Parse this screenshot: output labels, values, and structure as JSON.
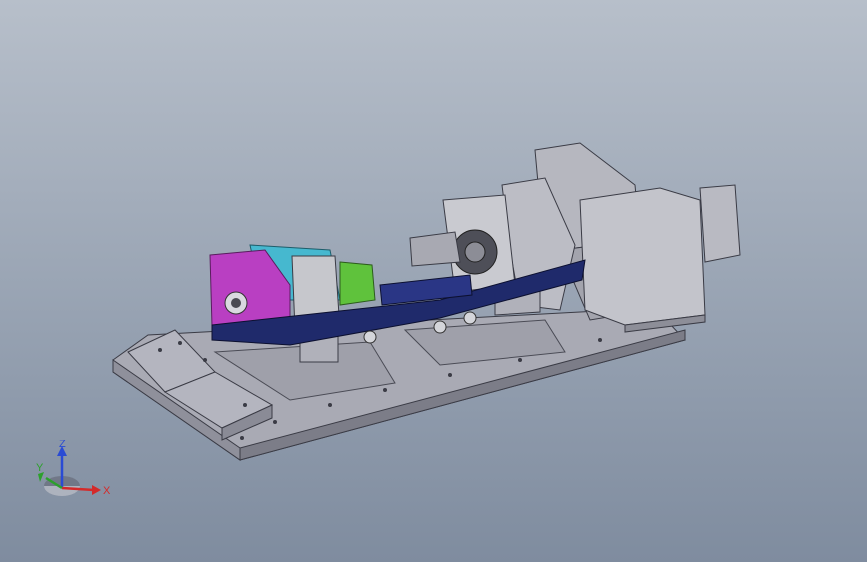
{
  "viewport": {
    "background_top": "#b7bfca",
    "background_bottom": "#7f8c9f"
  },
  "model": {
    "colors": {
      "base_plate": "#a9aab4",
      "base_edge": "#7c7d88",
      "blue_beam": "#1f2a6b",
      "magenta_block": "#b93fc2",
      "cyan_block": "#46b8cf",
      "grey_block": "#c6c7cc",
      "green_part": "#5fc23c",
      "motor": "#bdbfc6"
    },
    "icon": "3d-assembly-model"
  },
  "triad": {
    "x_label": "X",
    "y_label": "Y",
    "z_label": "Z",
    "x_color": "#d42a2a",
    "y_color": "#2ca02c",
    "z_color": "#2a4bd4",
    "icon": "axis-triad-icon"
  }
}
